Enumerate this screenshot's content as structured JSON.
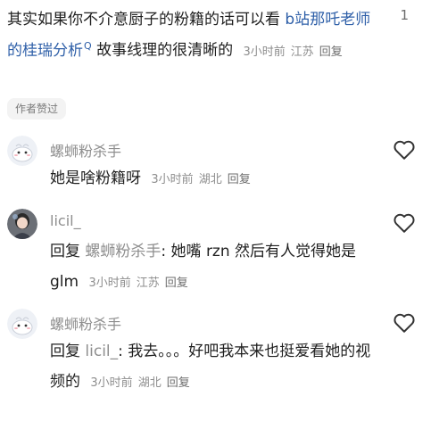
{
  "top_comment": {
    "text_part1": "其实如果你不介意厨子的粉籍的话可以看",
    "link_text": "b站那吒老师的桂瑞分析",
    "text_part2": "故事线理的很清晰的",
    "time": "3小时前",
    "location": "江苏",
    "reply_label": "回复",
    "like_count": "1",
    "author_liked_label": "作者赞过"
  },
  "replies": [
    {
      "username": "螺蛳粉杀手",
      "reply_prefix": "",
      "reply_to": "",
      "text": "她是啥粉籍呀",
      "time": "3小时前",
      "location": "湖北",
      "reply_label": "回复"
    },
    {
      "username": "licil_",
      "reply_prefix": "回复",
      "reply_to": "螺蛳粉杀手",
      "text": ": 她嘴 rzn 然后有人觉得她是 glm",
      "time": "3小时前",
      "location": "江苏",
      "reply_label": "回复"
    },
    {
      "username": "螺蛳粉杀手",
      "reply_prefix": "回复",
      "reply_to": "licil_",
      "text": ": 我去。。。好吧我本来也挺爱看她的视频的",
      "time": "3小时前",
      "location": "湖北",
      "reply_label": "回复"
    }
  ],
  "colors": {
    "link": "#2e5fa8",
    "meta": "#8e8e8e"
  }
}
